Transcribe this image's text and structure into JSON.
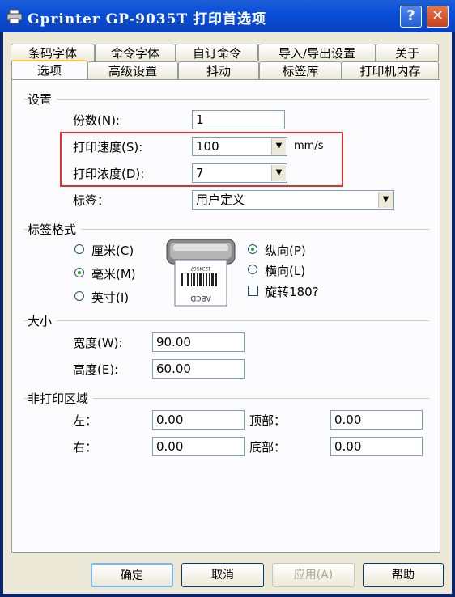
{
  "window": {
    "title": "Gprinter  GP-9035T 打印首选项",
    "help_label": "?",
    "close_label": "✕"
  },
  "tabs_back": [
    "条码字体",
    "命令字体",
    "自订命令",
    "导入/导出设置",
    "关于"
  ],
  "tabs_front": [
    "选项",
    "高级设置",
    "抖动",
    "标签库",
    "打印机内存"
  ],
  "settings": {
    "group_label": "设置",
    "copies_label": "份数(N):",
    "copies_value": "1",
    "speed_label": "打印速度(S):",
    "speed_value": "100",
    "speed_unit": "mm/s",
    "density_label": "打印浓度(D):",
    "density_value": "7",
    "label_label": "标签：",
    "label_value": "用户定义"
  },
  "label_format": {
    "group_label": "标签格式",
    "cm_label": "厘米(C)",
    "mm_label": "毫米(M)",
    "inch_label": "英寸(I)",
    "portrait_label": "纵向(P)",
    "landscape_label": "横向(L)",
    "rotate_label": "旋转180?",
    "unit_selected": "mm",
    "orientation_selected": "portrait",
    "rotate_checked": false,
    "preview_text": "ABCD",
    "preview_number": "1234567"
  },
  "size": {
    "group_label": "大小",
    "width_label": "宽度(W):",
    "width_value": "90.00",
    "height_label": "高度(E):",
    "height_value": "60.00"
  },
  "nonprint": {
    "group_label": "非打印区域",
    "left_label": "左：",
    "left_value": "0.00",
    "top_label": "顶部：",
    "top_value": "0.00",
    "right_label": "右：",
    "right_value": "0.00",
    "bottom_label": "底部：",
    "bottom_value": "0.00"
  },
  "buttons": {
    "ok": "确定",
    "cancel": "取消",
    "apply": "应用(A)",
    "help": "帮助"
  }
}
